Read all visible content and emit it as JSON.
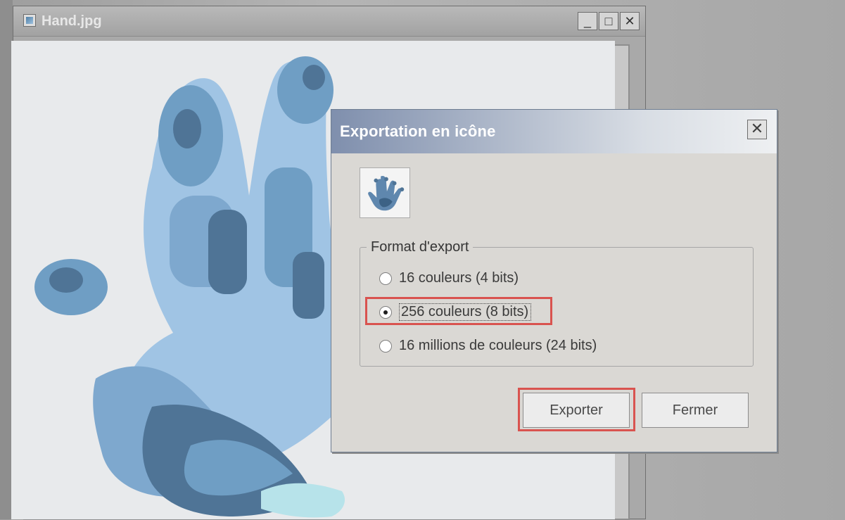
{
  "image_window": {
    "title": "Hand.jpg",
    "controls": {
      "minimize": "_",
      "maximize": "□",
      "close": "✕"
    }
  },
  "dialog": {
    "title": "Exportation en icône",
    "close_label": "✕",
    "group_label": "Format d'export",
    "options": [
      {
        "label": "16 couleurs (4 bits)",
        "selected": false
      },
      {
        "label": "256 couleurs (8 bits)",
        "selected": true
      },
      {
        "label": "16 millions de couleurs (24 bits)",
        "selected": false
      }
    ],
    "buttons": {
      "export": "Exporter",
      "close": "Fermer"
    }
  },
  "colors": {
    "highlight": "#d9534f",
    "hand_dark": "#4f7496",
    "hand_mid": "#6f9ec4",
    "hand_light": "#9cc2e4"
  },
  "icons": {
    "window_icon": "image-file-icon",
    "preview_icon": "hand-icon"
  }
}
